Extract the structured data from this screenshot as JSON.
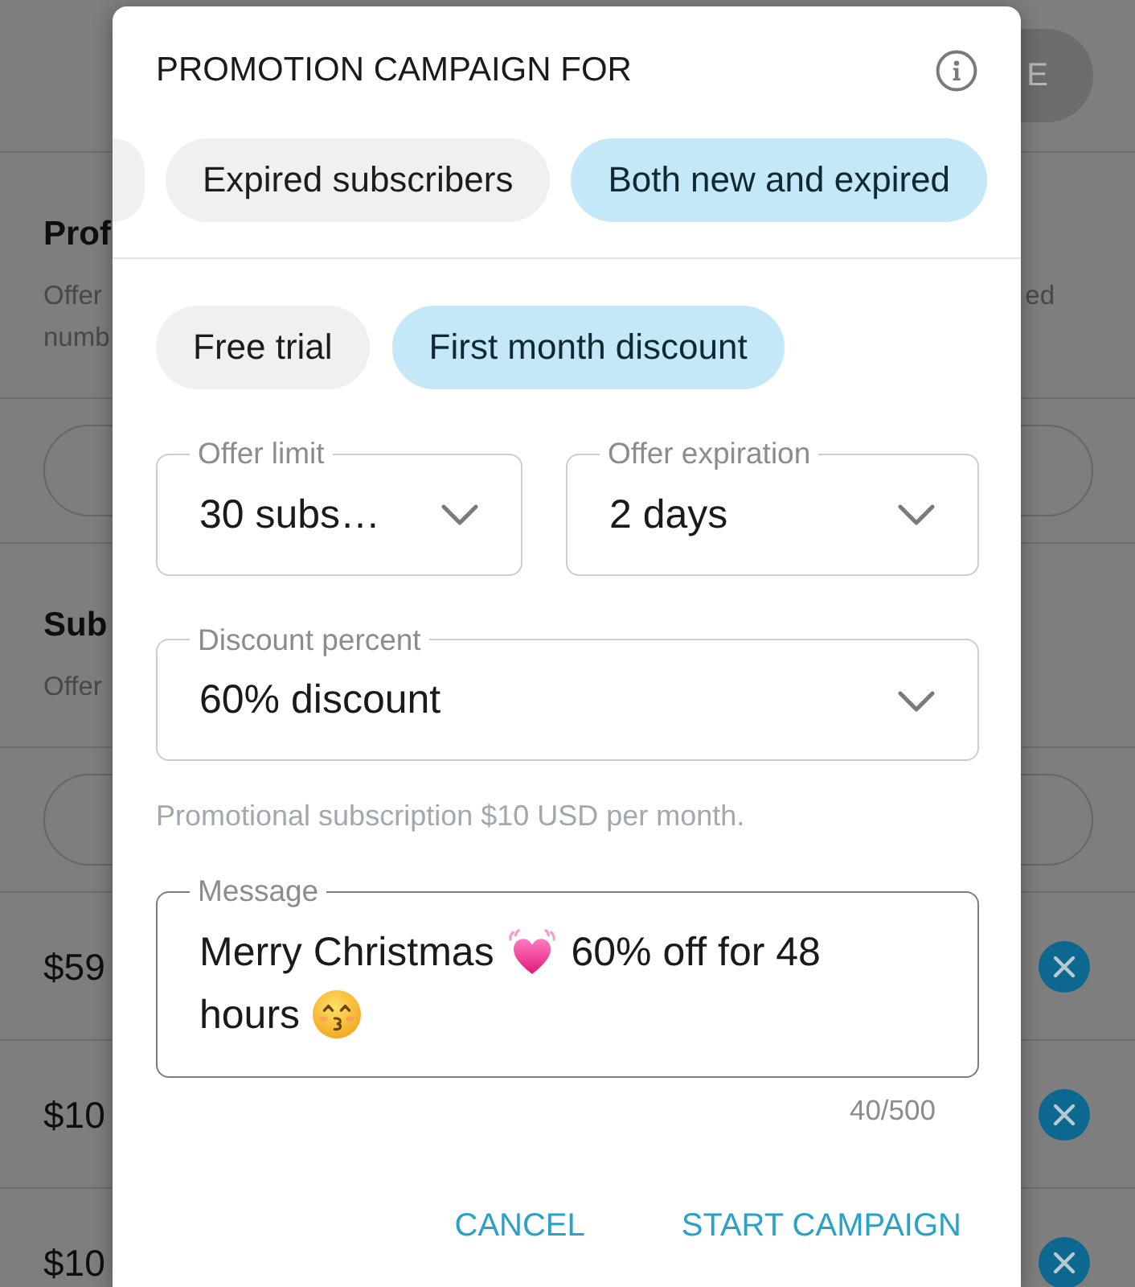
{
  "background_page": {
    "header_button": "E",
    "sections": [
      {
        "kind": "heading",
        "title": "Prof",
        "lines": [
          "Offer",
          "numb"
        ],
        "line_end": "ed"
      },
      {
        "kind": "button"
      },
      {
        "kind": "heading",
        "title": "Sub",
        "lines": [
          "Offer"
        ]
      },
      {
        "kind": "button"
      },
      {
        "kind": "price",
        "price": "$59"
      },
      {
        "kind": "price",
        "price": "$10"
      },
      {
        "kind": "price",
        "price": "$10"
      }
    ]
  },
  "dialog": {
    "title": "PROMOTION CAMPAIGN FOR",
    "audience_chips": [
      {
        "selected": false
      },
      {
        "label": "Expired subscribers",
        "selected": false
      },
      {
        "label": "Both new and expired",
        "selected": true
      }
    ],
    "offer_type_chips": [
      {
        "label": "Free trial",
        "selected": false
      },
      {
        "label": "First month discount",
        "selected": true
      }
    ],
    "fields": [
      {
        "label": "Offer limit",
        "value": "30 subs…"
      },
      {
        "label": "Offer expiration",
        "value": "2 days"
      },
      {
        "label": "Discount percent",
        "value": "60% discount"
      }
    ],
    "helper_text": "Promotional subscription $10 USD per month.",
    "message": {
      "label": "Message",
      "parts": [
        {
          "kind": "text",
          "text": "Merry Christmas"
        },
        {
          "kind": "heart"
        },
        {
          "kind": "text",
          "text": "60% off for 48 hours"
        },
        {
          "kind": "kiss"
        }
      ]
    },
    "counter": "40/500",
    "buttons": [
      "CANCEL",
      "START CAMPAIGN"
    ]
  }
}
